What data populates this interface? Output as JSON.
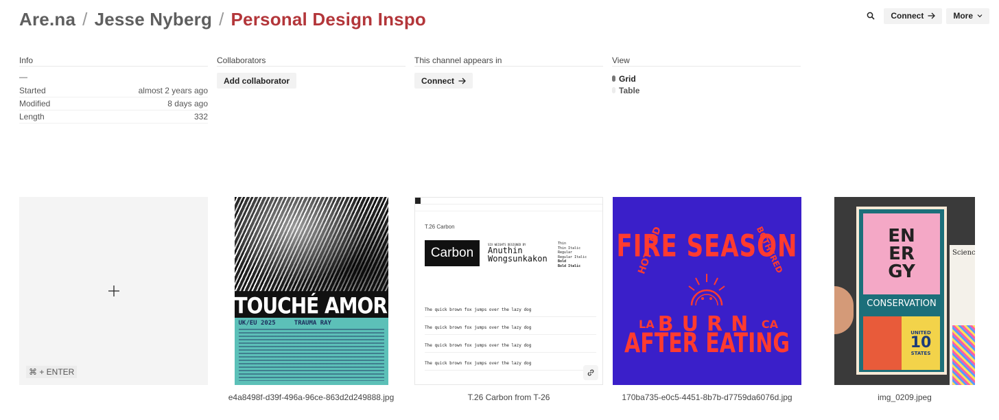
{
  "breadcrumb": {
    "site": "Are.na",
    "user": "Jesse Nyberg",
    "channel": "Personal Design Inspo",
    "separator": "/"
  },
  "top_actions": {
    "search_icon": "search-icon",
    "connect_label": "Connect",
    "more_label": "More"
  },
  "info": {
    "title": "Info",
    "description": "—",
    "rows": [
      {
        "label": "Started",
        "value": "almost 2 years ago"
      },
      {
        "label": "Modified",
        "value": "8 days ago"
      },
      {
        "label": "Length",
        "value": "332"
      }
    ]
  },
  "collaborators": {
    "title": "Collaborators",
    "add_label": "Add collaborator"
  },
  "appears_in": {
    "title": "This channel appears in",
    "connect_label": "Connect"
  },
  "view": {
    "title": "View",
    "options": [
      {
        "label": "Grid",
        "selected": true
      },
      {
        "label": "Table",
        "selected": false
      }
    ]
  },
  "add_block": {
    "hint": "⌘ + ENTER"
  },
  "blocks": [
    {
      "caption": "e4a8498f-d39f-496a-96ce-863d2d249888.jpg",
      "image_text": {
        "headline": "TOUCHÉ AMORÉ",
        "tour": "UK/EU 2025",
        "support": "TRAUMA RAY"
      }
    },
    {
      "caption": "T.26 Carbon from T-26",
      "image_text": {
        "title": "T.26 Carbon",
        "logo": "Carbon",
        "designer_prefix": "SIX WEIGHTS DESIGNED BY",
        "designer_first": "Anuthin",
        "designer_last": "Wongsunkakon",
        "weights": [
          "Thin",
          "Thin Italic",
          "Regular",
          "Regular Italic",
          "Bold",
          "Bold Italic"
        ],
        "specimen": "The quick brown fox jumps over the lazy dog"
      }
    },
    {
      "caption": "170ba735-e0c5-4451-8b7b-d7759da6076d.jpg",
      "image_text": {
        "left_side": "HOT AND",
        "right_side": "BOTHERED",
        "headline": "FIRE SEASON",
        "la": "LA",
        "burn": "BURN",
        "ca": "CA",
        "tagline": "AFTER EATING"
      }
    },
    {
      "caption": "img_0209.jpeg",
      "image_text": {
        "stamp_lines": [
          "EN",
          "ER",
          "GY"
        ],
        "stamp_word": "CONSERVATION",
        "stamp_country_top": "UNITED",
        "stamp_value": "10",
        "stamp_country_bottom": "STATES",
        "book": "Science"
      }
    }
  ],
  "colors": {
    "channel_accent": "#b3363a",
    "breadcrumb_gray": "#5f5f5f",
    "fire_bg": "#3a1fc9",
    "fire_text": "#ff3b2f",
    "touche_teal": "#5cc0b8"
  }
}
